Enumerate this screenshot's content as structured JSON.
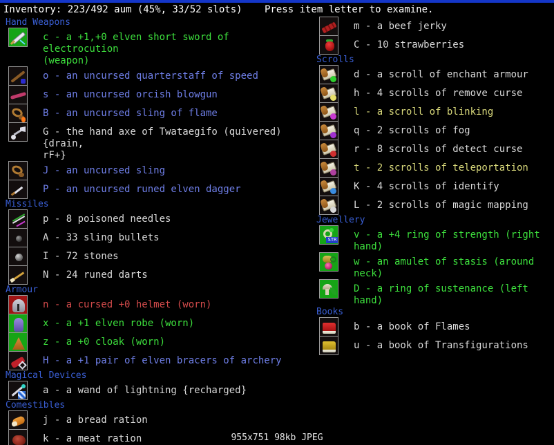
{
  "header": {
    "left": "Inventory: 223/492 aum (45%, 33/52 slots)",
    "right": "Press item letter to examine."
  },
  "footer": "955x751 98kb JPEG",
  "colors": {
    "topbar": "#1436c8",
    "section_title": "#3a5fd6",
    "equipped": "#3de03d",
    "unidentified_weapon": "#6f7fe8",
    "normal": "#d9d9d9",
    "useful": "#d7d77a",
    "cursed": "#d44b4b",
    "background": "#000000"
  },
  "left_column": [
    {
      "title": "Hand Weapons",
      "items": [
        {
          "letter": "c",
          "text": "a +1,+0 elven short sword of electrocution\n(weapon)",
          "color": "c-green",
          "icon": "short-sword-icon",
          "tile_bg": "bg-green",
          "two_line": true
        },
        {
          "letter": "o",
          "text": "an uncursed quarterstaff of speed",
          "color": "c-blue",
          "icon": "quarterstaff-icon",
          "tile_bg": "bg-dark",
          "two_line": false
        },
        {
          "letter": "s",
          "text": "an uncursed orcish blowgun",
          "color": "c-blue",
          "icon": "blowgun-icon",
          "tile_bg": "bg-dark",
          "two_line": false
        },
        {
          "letter": "B",
          "text": "an uncursed sling of flame",
          "color": "c-blue",
          "icon": "sling-of-flame-icon",
          "tile_bg": "bg-dark",
          "two_line": false
        },
        {
          "letter": "G",
          "text": "the hand axe of Twataegifo (quivered) {drain,\nrF+}",
          "color": "c-white",
          "icon": "hand-axe-icon",
          "tile_bg": "bg-dark",
          "two_line": true
        },
        {
          "letter": "J",
          "text": "an uncursed sling",
          "color": "c-blue",
          "icon": "sling-icon",
          "tile_bg": "bg-dark",
          "two_line": false
        },
        {
          "letter": "P",
          "text": "an uncursed runed elven dagger",
          "color": "c-blue",
          "icon": "elven-dagger-icon",
          "tile_bg": "bg-dark",
          "two_line": false
        }
      ]
    },
    {
      "title": "Missiles",
      "items": [
        {
          "letter": "p",
          "text": "8 poisoned needles",
          "color": "c-white",
          "icon": "poisoned-needles-icon",
          "tile_bg": "bg-dark",
          "two_line": false
        },
        {
          "letter": "A",
          "text": "33 sling bullets",
          "color": "c-white",
          "icon": "sling-bullets-icon",
          "tile_bg": "bg-dark",
          "two_line": false
        },
        {
          "letter": "I",
          "text": "72 stones",
          "color": "c-white",
          "icon": "stones-icon",
          "tile_bg": "bg-dark",
          "two_line": false
        },
        {
          "letter": "N",
          "text": "24 runed darts",
          "color": "c-white",
          "icon": "runed-darts-icon",
          "tile_bg": "bg-dark",
          "two_line": false
        }
      ]
    },
    {
      "title": "Armour",
      "items": [
        {
          "letter": "n",
          "text": "a cursed +0 helmet (worn)",
          "color": "c-red",
          "icon": "helmet-icon",
          "tile_bg": "bg-red",
          "two_line": false
        },
        {
          "letter": "x",
          "text": "a +1 elven robe (worn)",
          "color": "c-green",
          "icon": "elven-robe-icon",
          "tile_bg": "bg-green",
          "two_line": false
        },
        {
          "letter": "z",
          "text": "a +0 cloak (worn)",
          "color": "c-green",
          "icon": "cloak-icon",
          "tile_bg": "bg-green",
          "two_line": false
        },
        {
          "letter": "H",
          "text": "a +1 pair of elven bracers of archery",
          "color": "c-blue",
          "icon": "elven-bracers-icon",
          "tile_bg": "bg-dark",
          "two_line": false
        }
      ]
    },
    {
      "title": "Magical Devices",
      "items": [
        {
          "letter": "a",
          "text": "a wand of lightning {recharged}",
          "color": "c-white",
          "icon": "wand-icon",
          "tile_bg": "bg-dark",
          "two_line": false
        }
      ]
    },
    {
      "title": "Comestibles",
      "items": [
        {
          "letter": "j",
          "text": "a bread ration",
          "color": "c-white",
          "icon": "bread-ration-icon",
          "tile_bg": "bg-dark",
          "two_line": false
        },
        {
          "letter": "k",
          "text": "a meat ration",
          "color": "c-white",
          "icon": "meat-ration-icon",
          "tile_bg": "bg-dark",
          "two_line": false
        }
      ]
    }
  ],
  "right_column": [
    {
      "title": "",
      "items": [
        {
          "letter": "m",
          "text": "a beef jerky",
          "color": "c-white",
          "icon": "beef-jerky-icon",
          "tile_bg": "bg-dark",
          "two_line": false
        },
        {
          "letter": "C",
          "text": "10 strawberries",
          "color": "c-white",
          "icon": "strawberries-icon",
          "tile_bg": "bg-dark",
          "two_line": false
        }
      ]
    },
    {
      "title": "Scrolls",
      "items": [
        {
          "letter": "d",
          "text": "a scroll of enchant armour",
          "color": "c-white",
          "icon": "scroll-enchant-armour-icon",
          "tile_bg": "bg-dark",
          "two_line": false,
          "sigil": "#2fd02f"
        },
        {
          "letter": "h",
          "text": "4 scrolls of remove curse",
          "color": "c-white",
          "icon": "scroll-remove-curse-icon",
          "tile_bg": "bg-dark",
          "two_line": false,
          "sigil": "#e8e06a"
        },
        {
          "letter": "l",
          "text": "a scroll of blinking",
          "color": "c-yellow",
          "icon": "scroll-blinking-icon",
          "tile_bg": "bg-dark",
          "two_line": false,
          "sigil": "#c93ad0"
        },
        {
          "letter": "q",
          "text": "2 scrolls of fog",
          "color": "c-white",
          "icon": "scroll-fog-icon",
          "tile_bg": "bg-dark",
          "two_line": false,
          "sigil": "#a030d0"
        },
        {
          "letter": "r",
          "text": "8 scrolls of detect curse",
          "color": "c-white",
          "icon": "scroll-detect-curse-icon",
          "tile_bg": "bg-dark",
          "two_line": false,
          "sigil": "#d03030"
        },
        {
          "letter": "t",
          "text": "2 scrolls of teleportation",
          "color": "c-yellow",
          "icon": "scroll-teleportation-icon",
          "tile_bg": "bg-dark",
          "two_line": false,
          "sigil": "#b040a0"
        },
        {
          "letter": "K",
          "text": "4 scrolls of identify",
          "color": "c-white",
          "icon": "scroll-identify-icon",
          "tile_bg": "bg-dark",
          "two_line": false,
          "sigil": "#3a8ce0"
        },
        {
          "letter": "L",
          "text": "2 scrolls of magic mapping",
          "color": "c-white",
          "icon": "scroll-magic-mapping-icon",
          "tile_bg": "bg-dark",
          "two_line": false,
          "sigil": "#d8d8d8"
        }
      ]
    },
    {
      "title": "Jewellery",
      "items": [
        {
          "letter": "v",
          "text": "a +4 ring of strength (right hand)",
          "color": "c-green",
          "icon": "ring-of-strength-icon",
          "tile_bg": "bg-green",
          "two_line": false,
          "badge": "STR"
        },
        {
          "letter": "w",
          "text": "an amulet of stasis (around neck)",
          "color": "c-green",
          "icon": "amulet-of-stasis-icon",
          "tile_bg": "bg-green",
          "two_line": false
        },
        {
          "letter": "D",
          "text": "a ring of sustenance (left hand)",
          "color": "c-green",
          "icon": "ring-of-sustenance-icon",
          "tile_bg": "bg-green",
          "two_line": false
        }
      ]
    },
    {
      "title": "Books",
      "items": [
        {
          "letter": "b",
          "text": "a book of Flames",
          "color": "c-white",
          "icon": "book-of-flames-icon",
          "tile_bg": "bg-dark",
          "two_line": false,
          "book": "book-r"
        },
        {
          "letter": "u",
          "text": "a book of Transfigurations",
          "color": "c-white",
          "icon": "book-of-transfigurations-icon",
          "tile_bg": "bg-dark",
          "two_line": false,
          "book": "book-y"
        }
      ]
    }
  ]
}
